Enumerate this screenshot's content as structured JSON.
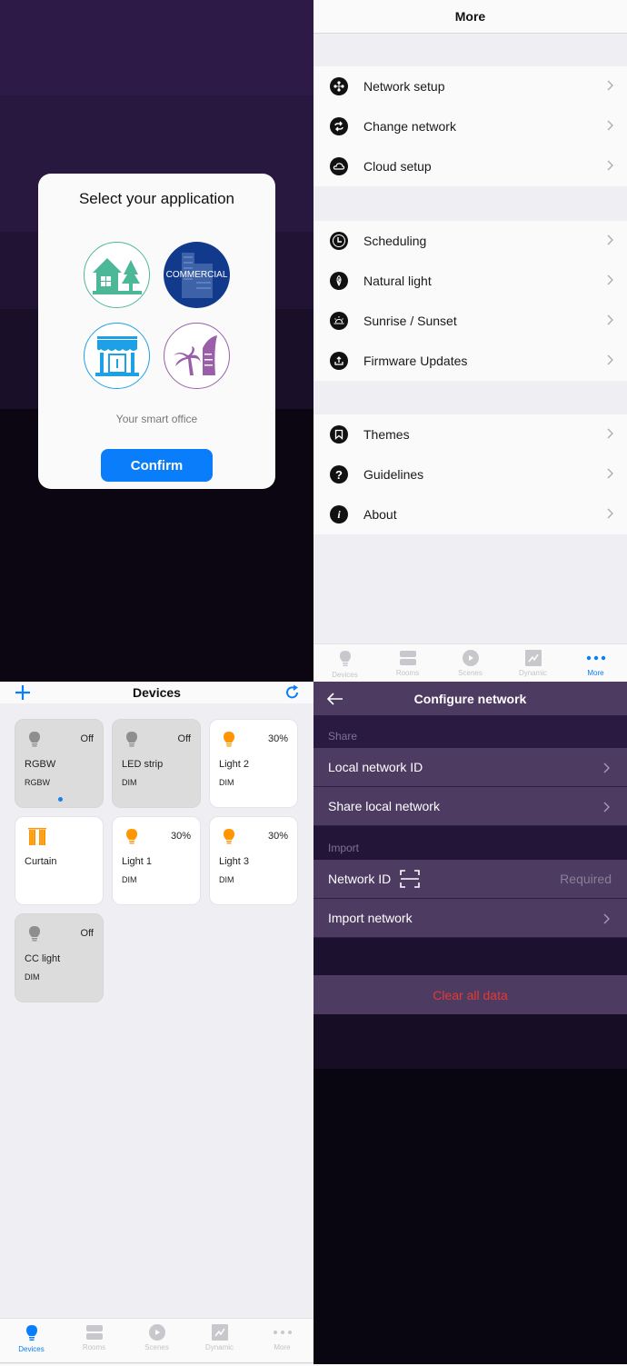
{
  "app_select": {
    "title": "Select your application",
    "options": [
      {
        "name": "Residential",
        "icon": "house-trees-icon",
        "color": "#4db897",
        "selected": false
      },
      {
        "name": "Commercial",
        "label": "COMMERCIAL",
        "icon": "building-icon",
        "color": "#123a8c",
        "selected": true
      },
      {
        "name": "Retail",
        "icon": "storefront-icon",
        "color": "#1ea0e6",
        "selected": false
      },
      {
        "name": "Hospitality",
        "icon": "palm-hotel-icon",
        "color": "#9a5fa8",
        "selected": false
      }
    ],
    "description": "Your smart office",
    "confirm_label": "Confirm"
  },
  "more": {
    "title": "More",
    "groups": [
      [
        {
          "label": "Network setup",
          "icon": "network-icon"
        },
        {
          "label": "Change network",
          "icon": "swap-icon"
        },
        {
          "label": "Cloud setup",
          "icon": "cloud-icon"
        }
      ],
      [
        {
          "label": "Scheduling",
          "icon": "clock-icon"
        },
        {
          "label": "Natural light",
          "icon": "leaf-icon"
        },
        {
          "label": "Sunrise / Sunset",
          "icon": "sunrise-icon"
        },
        {
          "label": "Firmware Updates",
          "icon": "upload-icon"
        }
      ],
      [
        {
          "label": "Themes",
          "icon": "bookmark-icon"
        },
        {
          "label": "Guidelines",
          "icon": "help-icon"
        },
        {
          "label": "About",
          "icon": "info-icon"
        }
      ]
    ]
  },
  "tabs": [
    "Devices",
    "Rooms",
    "Scenes",
    "Dynamic",
    "More"
  ],
  "more_active_tab": "More",
  "devices_active_tab": "Devices",
  "devices": {
    "title": "Devices",
    "items": [
      {
        "name": "RGBW",
        "type": "RGBW",
        "state": "Off",
        "icon": "bulb-icon",
        "on": false,
        "indicator": true
      },
      {
        "name": "LED strip",
        "type": "DIM",
        "state": "Off",
        "icon": "bulb-icon",
        "on": false
      },
      {
        "name": "Light 2",
        "type": "DIM",
        "state": "30%",
        "icon": "bulb-icon",
        "on": true
      },
      {
        "name": "Curtain",
        "type": "",
        "state": "",
        "icon": "curtain-icon",
        "on": true
      },
      {
        "name": "Light 1",
        "type": "DIM",
        "state": "30%",
        "icon": "bulb-icon",
        "on": true
      },
      {
        "name": "Light 3",
        "type": "DIM",
        "state": "30%",
        "icon": "bulb-icon",
        "on": true
      },
      {
        "name": "CC light",
        "type": "DIM",
        "state": "Off",
        "icon": "bulb-icon",
        "on": false
      }
    ]
  },
  "configure": {
    "title": "Configure network",
    "share_section": "Share",
    "share_rows": [
      "Local network ID",
      "Share local network"
    ],
    "import_section": "Import",
    "network_id_label": "Network ID",
    "network_id_placeholder": "Required",
    "import_row": "Import network",
    "clear_label": "Clear all data"
  },
  "colors": {
    "accent": "#0a7dfa",
    "on_icon": "#ff9500",
    "danger": "#e53935"
  }
}
